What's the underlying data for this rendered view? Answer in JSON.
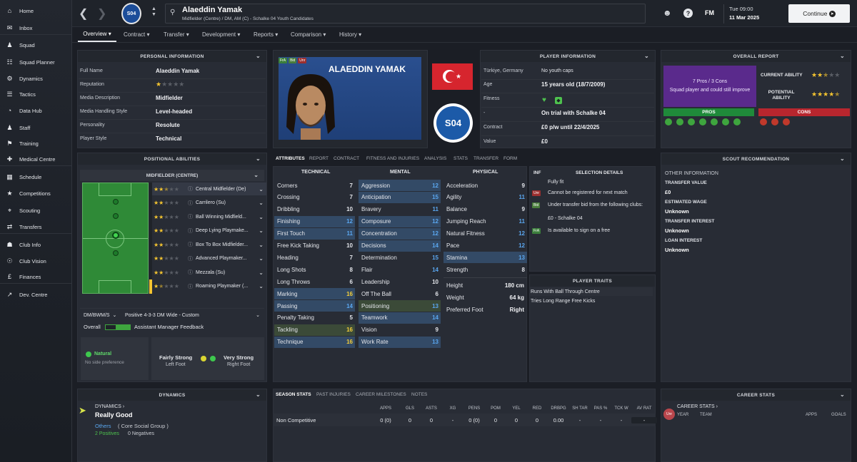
{
  "sidebar": {
    "items": [
      {
        "label": "Home",
        "icon": "home-icon"
      },
      {
        "label": "Inbox",
        "icon": "inbox-icon"
      },
      {
        "label": "Squad",
        "icon": "squad-icon"
      },
      {
        "label": "Squad Planner",
        "icon": "squad-planner-icon"
      },
      {
        "label": "Dynamics",
        "icon": "dynamics-icon"
      },
      {
        "label": "Tactics",
        "icon": "tactics-icon"
      },
      {
        "label": "Data Hub",
        "icon": "data-hub-icon"
      },
      {
        "label": "Staff",
        "icon": "staff-icon"
      },
      {
        "label": "Training",
        "icon": "training-icon"
      },
      {
        "label": "Medical Centre",
        "icon": "medical-icon"
      },
      {
        "label": "Schedule",
        "icon": "schedule-icon"
      },
      {
        "label": "Competitions",
        "icon": "trophy-icon"
      },
      {
        "label": "Scouting",
        "icon": "scouting-icon"
      },
      {
        "label": "Transfers",
        "icon": "transfers-icon"
      },
      {
        "label": "Club Info",
        "icon": "club-info-icon"
      },
      {
        "label": "Club Vision",
        "icon": "club-vision-icon"
      },
      {
        "label": "Finances",
        "icon": "finances-icon"
      },
      {
        "label": "Dev. Centre",
        "icon": "dev-centre-icon"
      }
    ]
  },
  "header": {
    "player_name": "Alaeddin Yamak",
    "subtitle": "Midfielder (Centre) / DM, AM (C) - Schalke 04 Youth Candidates",
    "crest_text": "S04",
    "brand": "FM",
    "time": "Tue 09:00",
    "date": "11 Mar 2025",
    "continue_label": "Continue"
  },
  "tabs": [
    "Overview",
    "Contract",
    "Transfer",
    "Development",
    "Reports",
    "Comparison",
    "History"
  ],
  "personal": {
    "title": "PERSONAL INFORMATION",
    "rows": [
      {
        "label": "Full Name",
        "value": "Alaeddin Yamak"
      },
      {
        "label": "Reputation",
        "value": ""
      },
      {
        "label": "Media Description",
        "value": "Midfielder"
      },
      {
        "label": "Media Handling Style",
        "value": "Level-headed"
      },
      {
        "label": "Personality",
        "value": "Resolute"
      },
      {
        "label": "Player Style",
        "value": "Technical"
      }
    ]
  },
  "profile": {
    "name_caps": "ALAEDDIN YAMAK",
    "badges": [
      "FrA",
      "Bid",
      "Unr"
    ],
    "club_crest": "S04"
  },
  "player_info": {
    "title": "PLAYER INFORMATION",
    "rows": [
      {
        "label": "Türkiye, Germany",
        "value": "No youth caps"
      },
      {
        "label": "Age",
        "value": "15 years old (18/7/2009)"
      },
      {
        "label": "Fitness",
        "value": ""
      },
      {
        "label": "-",
        "value": "On trial with Schalke 04"
      },
      {
        "label": "Contract",
        "value": "£0 p/w until 22/4/2025"
      },
      {
        "label": "Value",
        "value": "£0"
      }
    ]
  },
  "overall_report": {
    "title": "OVERALL REPORT",
    "summary_line1": "7 Pros / 3 Cons",
    "summary_line2": "Squad player and could still improve",
    "current_ability_label": "CURRENT ABILITY",
    "potential_ability_label": "POTENTIAL ABILITY",
    "pros_label": "PROS",
    "cons_label": "CONS"
  },
  "positional": {
    "title": "POSITIONAL ABILITIES",
    "position": "MIDFIELDER (CENTRE)",
    "roles": [
      {
        "name": "Central Midfielder (De)",
        "stars": 2.5
      },
      {
        "name": "Carrilero (Su)",
        "stars": 2
      },
      {
        "name": "Ball Winning Midfield...",
        "stars": 2
      },
      {
        "name": "Deep Lying Playmake...",
        "stars": 2
      },
      {
        "name": "Box To Box Midfielder...",
        "stars": 2
      },
      {
        "name": "Advanced Playmaker...",
        "stars": 2
      },
      {
        "name": "Mezzala (Su)",
        "stars": 2
      },
      {
        "name": "Roaming Playmaker (...",
        "stars": 1.5
      }
    ],
    "formation_code": "DM/BWM/S",
    "formation_name": "Positive 4-3-3 DM Wide - Custom",
    "overall_label": "Overall",
    "assistant_label": "Assistant Manager Feedback",
    "natural_label": "Natural",
    "no_side": "No side preference",
    "left_foot_label": "Fairly Strong",
    "left_foot_sub": "Left Foot",
    "right_foot_label": "Very Strong",
    "right_foot_sub": "Right Foot"
  },
  "attribute_tabs": [
    "ATTRIBUTES",
    "REPORT",
    "CONTRACT",
    "FITNESS AND INJURIES",
    "ANALYSIS",
    "STATS",
    "TRANSFER",
    "FORM"
  ],
  "attributes": {
    "technical_label": "TECHNICAL",
    "mental_label": "MENTAL",
    "physical_label": "PHYSICAL",
    "technical": [
      {
        "name": "Corners",
        "value": "7"
      },
      {
        "name": "Crossing",
        "value": "7"
      },
      {
        "name": "Dribbling",
        "value": "10"
      },
      {
        "name": "Finishing",
        "value": "12"
      },
      {
        "name": "First Touch",
        "value": "11"
      },
      {
        "name": "Free Kick Taking",
        "value": "10"
      },
      {
        "name": "Heading",
        "value": "7"
      },
      {
        "name": "Long Shots",
        "value": "8"
      },
      {
        "name": "Long Throws",
        "value": "6"
      },
      {
        "name": "Marking",
        "value": "16"
      },
      {
        "name": "Passing",
        "value": "14"
      },
      {
        "name": "Penalty Taking",
        "value": "5"
      },
      {
        "name": "Tackling",
        "value": "16"
      },
      {
        "name": "Technique",
        "value": "16"
      }
    ],
    "mental": [
      {
        "name": "Aggression",
        "value": "12"
      },
      {
        "name": "Anticipation",
        "value": "15"
      },
      {
        "name": "Bravery",
        "value": "11"
      },
      {
        "name": "Composure",
        "value": "12"
      },
      {
        "name": "Concentration",
        "value": "12"
      },
      {
        "name": "Decisions",
        "value": "14"
      },
      {
        "name": "Determination",
        "value": "15"
      },
      {
        "name": "Flair",
        "value": "14"
      },
      {
        "name": "Leadership",
        "value": "10"
      },
      {
        "name": "Off The Ball",
        "value": "6"
      },
      {
        "name": "Positioning",
        "value": "13"
      },
      {
        "name": "Teamwork",
        "value": "14"
      },
      {
        "name": "Vision",
        "value": "9"
      },
      {
        "name": "Work Rate",
        "value": "13"
      }
    ],
    "physical": [
      {
        "name": "Acceleration",
        "value": "9"
      },
      {
        "name": "Agility",
        "value": "11"
      },
      {
        "name": "Balance",
        "value": "9"
      },
      {
        "name": "Jumping Reach",
        "value": "11"
      },
      {
        "name": "Natural Fitness",
        "value": "12"
      },
      {
        "name": "Pace",
        "value": "12"
      },
      {
        "name": "Stamina",
        "value": "13"
      },
      {
        "name": "Strength",
        "value": "8"
      }
    ],
    "height_label": "Height",
    "height": "180 cm",
    "weight_label": "Weight",
    "weight": "64 kg",
    "foot_label": "Preferred Foot",
    "foot": "Right"
  },
  "selection": {
    "inf_label": "INF",
    "title": "SELECTION DETAILS",
    "items": [
      {
        "badge": "",
        "text": "Fully fit"
      },
      {
        "badge": "Unr",
        "text": "Cannot be registered for next match"
      },
      {
        "badge": "Bid",
        "text": "Under transfer bid from the following clubs:"
      },
      {
        "badge": "",
        "text": "£0 - Schalke 04"
      },
      {
        "badge": "FrA",
        "text": "Is available to sign on a free"
      }
    ]
  },
  "traits": {
    "title": "PLAYER TRAITS",
    "items": [
      "Runs With Ball Through Centre",
      "Tries Long Range Free Kicks"
    ]
  },
  "scout": {
    "title": "SCOUT RECOMMENDATION",
    "other_info": "OTHER INFORMATION",
    "rows": [
      {
        "label": "TRANSFER VALUE",
        "value": "£0"
      },
      {
        "label": "ESTIMATED WAGE",
        "value": "Unknown"
      },
      {
        "label": "TRANSFER INTEREST",
        "value": "Unknown"
      },
      {
        "label": "LOAN INTEREST",
        "value": "Unknown"
      }
    ]
  },
  "dynamics": {
    "title": "DYNAMICS",
    "link": "DYNAMICS",
    "status": "Really Good",
    "group_link": "Others",
    "group_text": "( Core Social Group )",
    "positives": "2 Positives",
    "negatives": "0 Negatives"
  },
  "season_tabs": [
    "SEASON STATS",
    "PAST INJURIES",
    "CAREER MILESTONES",
    "NOTES"
  ],
  "season": {
    "headers": [
      "APPS",
      "GLS",
      "ASTS",
      "XG",
      "PENS",
      "POM",
      "YEL",
      "RED",
      "DRBPG",
      "SH TAR",
      "PAS %",
      "TCK W",
      "AV RAT"
    ],
    "row_label": "Non Competitive",
    "values": [
      "0 (0)",
      "0",
      "0",
      "-",
      "0 (0)",
      "0",
      "0",
      "0",
      "0.00",
      "-",
      "-",
      "-",
      "-"
    ]
  },
  "career": {
    "title": "CAREER STATS",
    "link": "CAREER STATS",
    "year": "YEAR",
    "team": "TEAM",
    "apps": "APPS",
    "goals": "GOALS"
  },
  "colors": {
    "accent_green": "#3ea53e",
    "accent_red": "#c0392b",
    "blue_value": "#5aa7f0",
    "yellow_value": "#f4cf3a"
  }
}
